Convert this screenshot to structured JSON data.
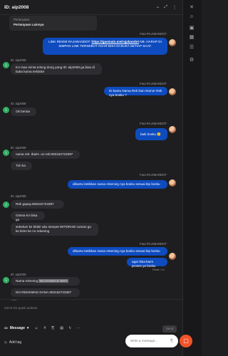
{
  "header": {
    "title": "ID: aip2008",
    "icons": [
      "tag-icon",
      "expand-icon",
      "more-icon"
    ]
  },
  "thread": {
    "quote": {
      "label": "Pertanyaan:",
      "text": "Pertanyaan Lainnya"
    },
    "messages": [
      {
        "side": "out",
        "sender": "Fara RAJABANDOT",
        "text_before": "LINK RESMI RAJABANDOT: ",
        "link": "https://gasmain.me/rajabandot",
        "text_after": " NB. HARAP DI SIMPAN LINK TERSEBUT AGAR BISA DI BUKA SETIAP SAAT."
      },
      {
        "side": "in",
        "sender": "ID: aip2008",
        "text": "KA mau minta tolong dong yang ID: aip2008 ga bisa di buka karna terblokir"
      },
      {
        "side": "out",
        "sender": "Fara RAJABANDOT",
        "text": "Di bantu Nama Rek Dan Nomor Rek nya bosku ?"
      },
      {
        "side": "in",
        "sender": "ID: aip2008",
        "text": "Ok bentar"
      },
      {
        "side": "out",
        "sender": "Fara RAJABANDOT",
        "text": "baik bosku 😊"
      },
      {
        "side": "in",
        "sender": "ID: aip2008",
        "text": "nama rek: Ibaim .no rek:083162723397"
      },
      {
        "side": "in",
        "sender": "",
        "text": "Tuh ka"
      },
      {
        "side": "out",
        "sender": "Fara RAJABANDOT",
        "text": "dibantu ketikkan nama rekening nya bosku sesuai ktp bosku"
      },
      {
        "side": "in",
        "sender": "ID: aip2008",
        "text": "Rek gopay.083162723397"
      },
      {
        "side": "in",
        "sender": "",
        "text": "Gimna KA bisa ga"
      },
      {
        "side": "in",
        "sender": "",
        "text": "sebelum ke blokir aku sempet WITDRAW cuman ga ke kirim ke no rekening"
      },
      {
        "side": "out",
        "sender": "Fara RAJABANDOT",
        "text": "dibantu ketikkan nama rekening nya bosku sesuai ktp bosku"
      },
      {
        "side": "out",
        "sender": "",
        "text": "agar bisa kami proses ya bosku"
      },
      {
        "side": "in",
        "sender": "ID: aip2008",
        "text_before": "Nama rekening ",
        "masked": "MUHAMMAD IBRA",
        "text_after": ""
      },
      {
        "side": "in",
        "sender": "",
        "text": "NO REKENING DANA.083162723397"
      }
    ],
    "seen": "Read • 1s",
    "last_time": "now"
  },
  "composer": {
    "hint": "ctrl+K for quick actions",
    "message_label": "Message",
    "send_label": "Send",
    "add_tag_label": "Add tag"
  },
  "widget": {
    "placeholder": "Write a message..."
  },
  "colors": {
    "outgoing_bubble": "#0e4bbf",
    "incoming_bubble": "#2d2d31",
    "avatar": "#2fae62",
    "accent_fab": "#f0532a"
  }
}
